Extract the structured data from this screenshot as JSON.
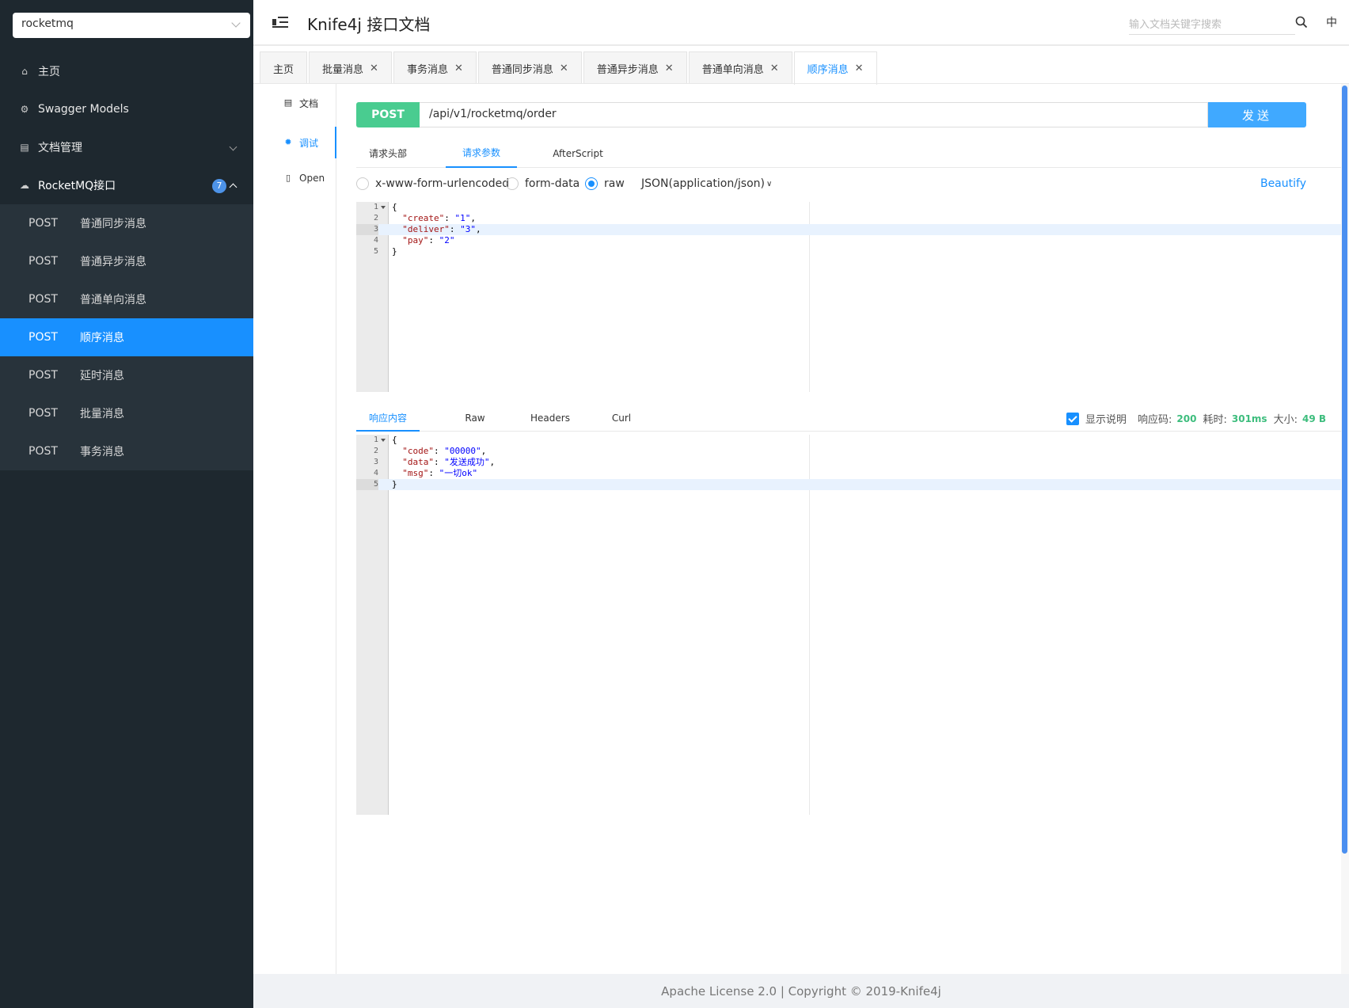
{
  "sidebar": {
    "project_select": "rocketmq",
    "menu": [
      {
        "label": "主页",
        "icon": "home-icon"
      },
      {
        "label": "Swagger Models",
        "icon": "model-icon"
      },
      {
        "label": "文档管理",
        "icon": "docs-manage-icon"
      },
      {
        "label": "RocketMQ接口",
        "icon": "cloud-icon",
        "badge": "7"
      }
    ],
    "sub_items": [
      {
        "method": "POST",
        "label": "普通同步消息"
      },
      {
        "method": "POST",
        "label": "普通异步消息"
      },
      {
        "method": "POST",
        "label": "普通单向消息"
      },
      {
        "method": "POST",
        "label": "顺序消息"
      },
      {
        "method": "POST",
        "label": "延时消息"
      },
      {
        "method": "POST",
        "label": "批量消息"
      },
      {
        "method": "POST",
        "label": "事务消息"
      }
    ]
  },
  "header": {
    "title": "Knife4j 接口文档",
    "search_placeholder": "输入文档关键字搜索",
    "lang": "中"
  },
  "tabs": [
    {
      "label": "主页"
    },
    {
      "label": "批量消息"
    },
    {
      "label": "事务消息"
    },
    {
      "label": "普通同步消息"
    },
    {
      "label": "普通异步消息"
    },
    {
      "label": "普通单向消息"
    },
    {
      "label": "顺序消息"
    }
  ],
  "subnav": [
    {
      "label": "文档",
      "icon": "document-icon"
    },
    {
      "label": "调试",
      "icon": "bug-icon"
    },
    {
      "label": "Open",
      "icon": "file-icon"
    }
  ],
  "request": {
    "method": "POST",
    "url": "/api/v1/rocketmq/order",
    "send_label": "发送"
  },
  "request_tabs": [
    "请求头部",
    "请求参数",
    "AfterScript"
  ],
  "content_types": {
    "urlencoded": "x-www-form-urlencoded",
    "formdata": "form-data",
    "raw": "raw",
    "json": "JSON(application/json)",
    "beautify": "Beautify"
  },
  "request_body": {
    "lines": [
      "1",
      "2",
      "3",
      "4",
      "5"
    ],
    "l1": "{",
    "l2k": "\"create\"",
    "l2v": "\"1\"",
    "l3k": "\"deliver\"",
    "l3v": "\"3\"",
    "l4k": "\"pay\"",
    "l4v": "\"2\"",
    "l5": "}"
  },
  "response_tabs": [
    "响应内容",
    "Raw",
    "Headers",
    "Curl"
  ],
  "response_info": {
    "show_desc": "显示说明",
    "code_label": "响应码:",
    "code": "200",
    "time_label": "耗时:",
    "time": "301ms",
    "size_label": "大小:",
    "size": "49 B"
  },
  "response_body": {
    "lines": [
      "1",
      "2",
      "3",
      "4",
      "5"
    ],
    "l1": "{",
    "l2k": "\"code\"",
    "l2v": "\"00000\"",
    "l3k": "\"data\"",
    "l3v": "\"发送成功\"",
    "l4k": "\"msg\"",
    "l4v": "\"一切ok\"",
    "l5": "}"
  },
  "footer": "Apache License 2.0 | Copyright © 2019-Knife4j"
}
